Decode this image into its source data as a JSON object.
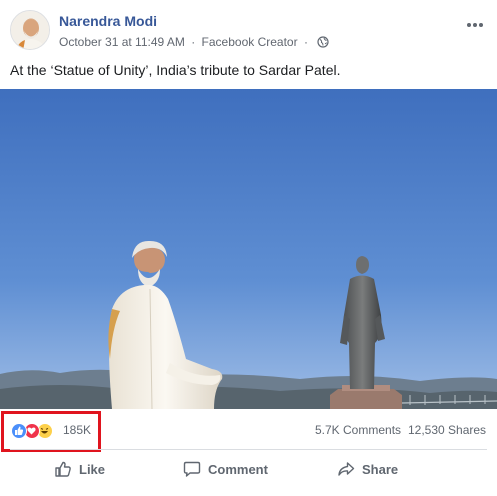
{
  "post": {
    "author": "Narendra Modi",
    "timestamp": "October 31 at 11:49 AM",
    "separator": "·",
    "source": "Facebook Creator",
    "privacy_icon": "globe-icon",
    "caption": "At the ‘Statue of Unity’, India’s tribute to Sardar Patel."
  },
  "stats": {
    "reaction_icons": [
      "like-reaction-icon",
      "love-reaction-icon",
      "haha-reaction-icon"
    ],
    "reaction_count": "185K",
    "comments": "5.7K Comments",
    "shares": "12,530 Shares"
  },
  "actions": {
    "like": "Like",
    "comment": "Comment",
    "share": "Share"
  },
  "colors": {
    "author_link": "#385898",
    "highlight_box": "#e0141e",
    "like_reaction": "#4b8ffa",
    "love_reaction": "#f0334b",
    "haha_reaction": "#fdd04a"
  }
}
